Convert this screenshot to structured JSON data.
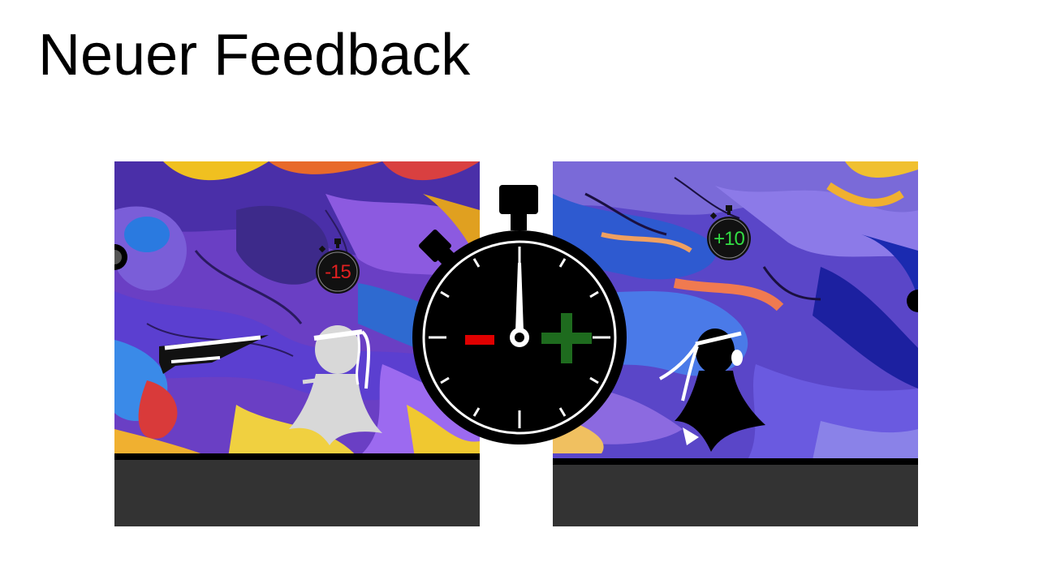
{
  "slide": {
    "title": "Neuer Feedback"
  },
  "left_panel": {
    "time_badge": "-15",
    "time_badge_color": "#e02020"
  },
  "right_panel": {
    "time_badge": "+10",
    "time_badge_color": "#33dd44"
  },
  "center_stopwatch": {
    "minus_color": "#e00000",
    "plus_color": "#1e6b1e"
  },
  "colors": {
    "floor": "#333333",
    "floor_edge": "#000000"
  }
}
